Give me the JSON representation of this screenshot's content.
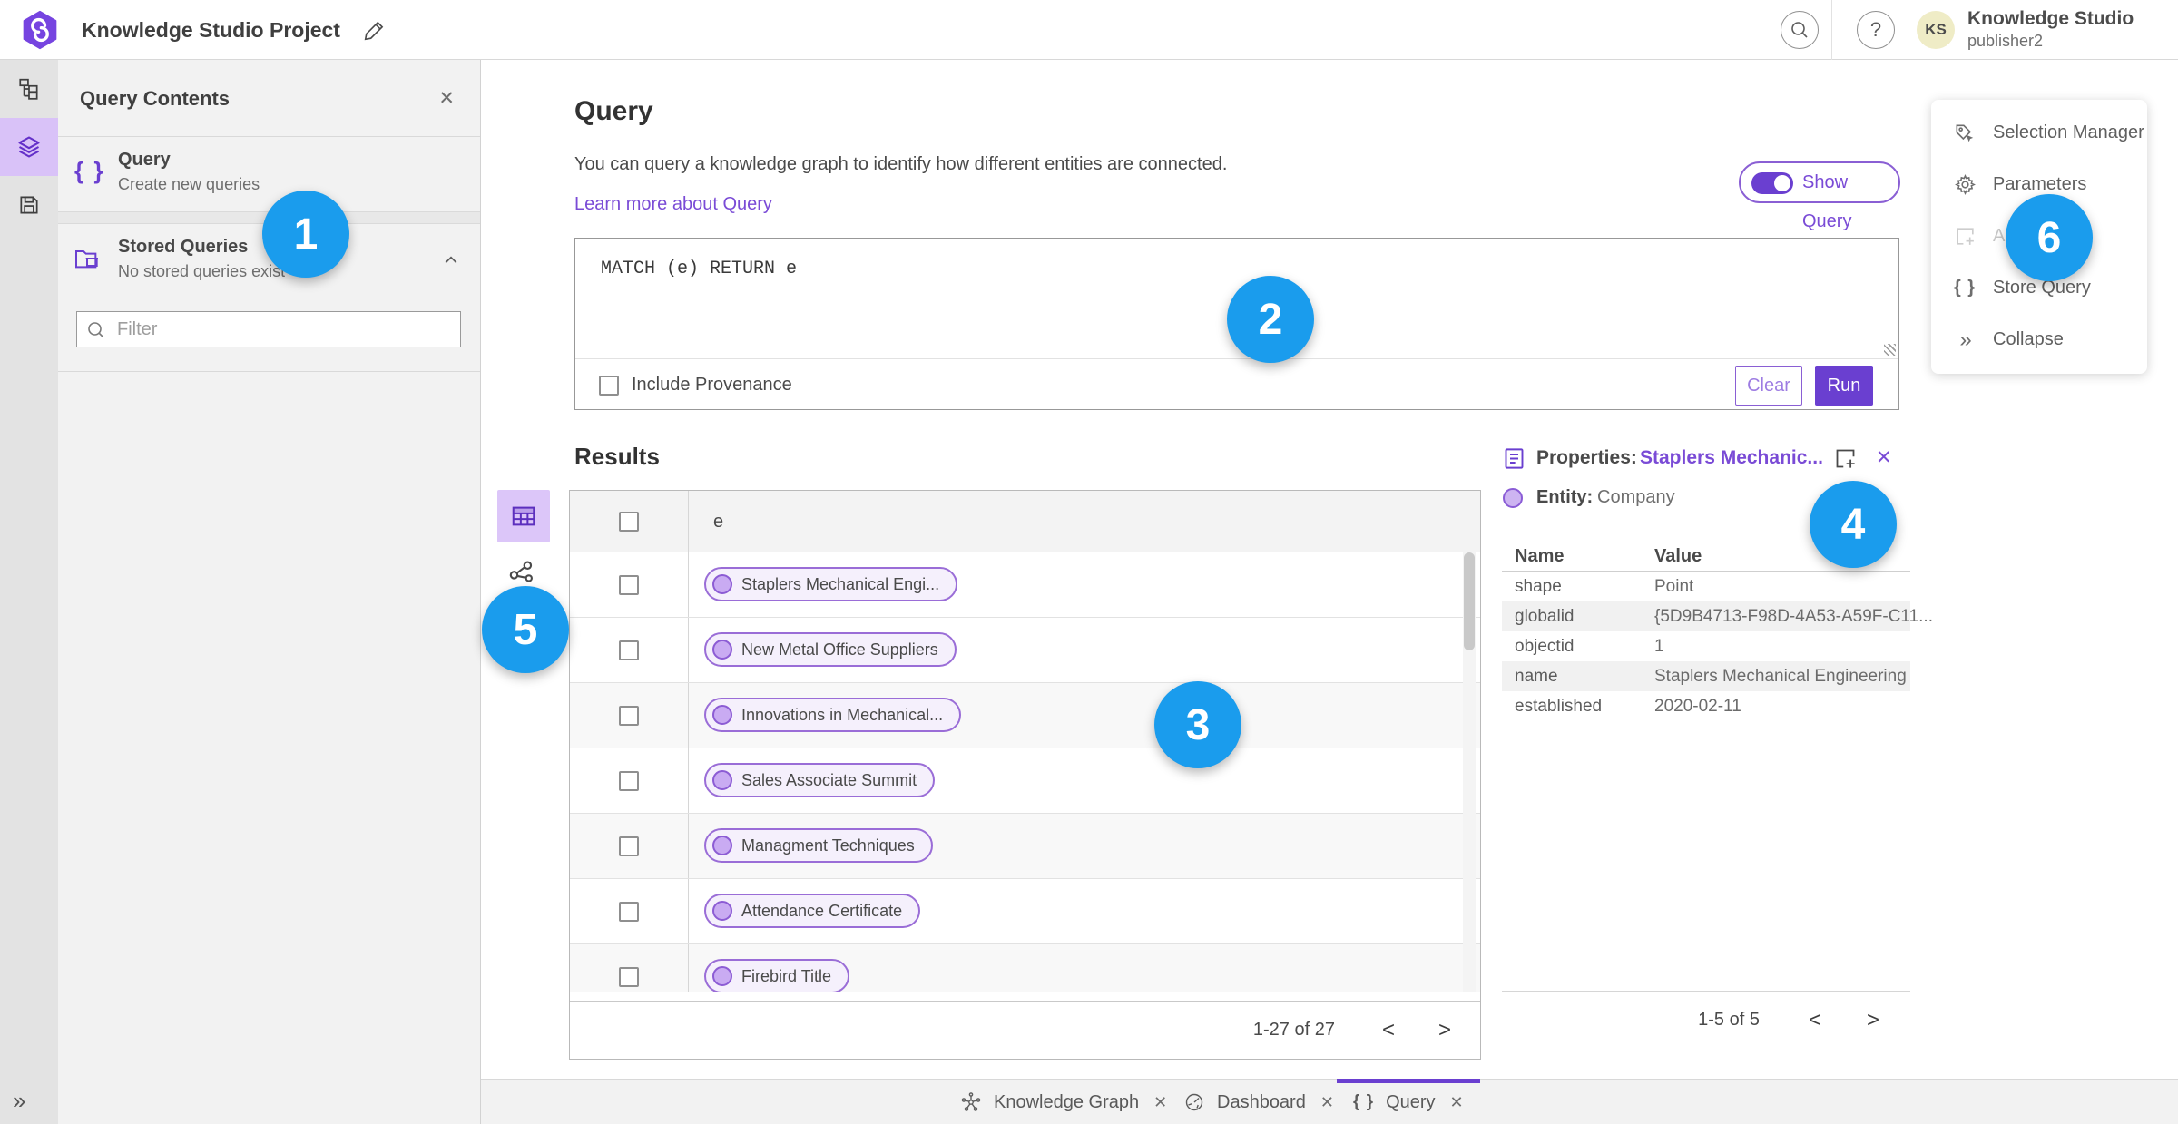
{
  "topbar": {
    "title": "Knowledge Studio Project",
    "user_name": "Knowledge Studio",
    "user_role": "publisher2",
    "avatar_initials": "KS"
  },
  "left_panel": {
    "title": "Query Contents",
    "query_item": {
      "title": "Query",
      "subtitle": "Create new queries"
    },
    "stored_item": {
      "title": "Stored Queries",
      "subtitle": "No stored queries exist"
    },
    "filter_placeholder": "Filter"
  },
  "query_panel": {
    "title": "Query",
    "description": "You can query a knowledge graph to identify how different entities are connected.",
    "learn_more": "Learn more about Query",
    "show_query": "Show Query",
    "query_text": "MATCH (e) RETURN e",
    "include_provenance": "Include Provenance",
    "clear": "Clear",
    "run": "Run"
  },
  "results": {
    "title": "Results",
    "column_header": "e",
    "rows": [
      "Staplers Mechanical Engi...",
      "New Metal Office Suppliers",
      "Innovations in Mechanical...",
      "Sales Associate Summit",
      "Managment Techniques",
      "Attendance Certificate",
      "Firebird Title"
    ],
    "pagination": "1-27 of 27"
  },
  "properties": {
    "title": "Properties:",
    "link": "Staplers Mechanic...",
    "entity_label": "Entity:",
    "entity_value": "Company",
    "name_header": "Name",
    "value_header": "Value",
    "rows": [
      {
        "name": "shape",
        "value": "Point"
      },
      {
        "name": "globalid",
        "value": "{5D9B4713-F98D-4A53-A59F-C11..."
      },
      {
        "name": "objectid",
        "value": "1"
      },
      {
        "name": "name",
        "value": "Staplers Mechanical Engineering"
      },
      {
        "name": "established",
        "value": "2020-02-11"
      }
    ],
    "pagination": "1-5 of 5"
  },
  "right_menu": {
    "selection_manager": "Selection Manager",
    "parameters": "Parameters",
    "add": "Add",
    "store_query": "Store Query",
    "collapse": "Collapse"
  },
  "tabs": [
    {
      "label": "Knowledge Graph"
    },
    {
      "label": "Dashboard"
    },
    {
      "label": "Query"
    }
  ],
  "annotations": [
    "1",
    "2",
    "3",
    "4",
    "5",
    "6"
  ],
  "icons": {
    "close": "✕",
    "braces": "{ }",
    "collapse": "»",
    "expand": "»",
    "help": "?",
    "prev": "<",
    "next": ">"
  },
  "colors": {
    "primary_purple": "#6a3fd0",
    "link_purple": "#7a4bd6",
    "annotation_blue": "#1a9ced"
  }
}
